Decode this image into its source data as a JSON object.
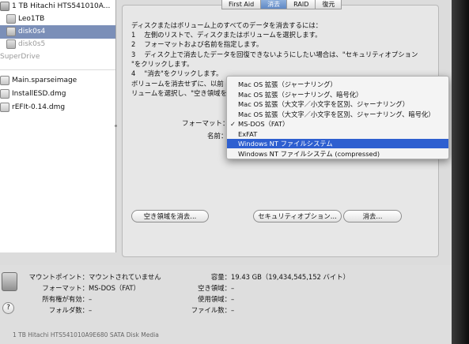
{
  "sidebar": {
    "items": [
      {
        "label": "1 TB Hitachi HTS541010A...",
        "state": "normal",
        "icon": "disk-icon"
      },
      {
        "label": "Leo1TB",
        "state": "normal",
        "icon": "volume-icon"
      },
      {
        "label": "disk0s4",
        "state": "selected",
        "icon": "volume-icon"
      },
      {
        "label": "disk0s5",
        "state": "gray",
        "icon": "volume-icon"
      },
      {
        "label": "SuperDrive",
        "state": "gray",
        "icon": "optical-drive-icon"
      },
      {
        "label": "Main.sparseimage",
        "state": "normal",
        "icon": "disk-image-icon"
      },
      {
        "label": "InstallESD.dmg",
        "state": "normal",
        "icon": "disk-image-icon"
      },
      {
        "label": "rEFIt-0.14.dmg",
        "state": "normal",
        "icon": "disk-image-icon"
      }
    ]
  },
  "tabs": [
    "First Aid",
    "消去",
    "RAID",
    "復元"
  ],
  "instructions": [
    "ディスクまたはボリューム上のすべてのデータを消去するには：",
    "1　 左側のリストで、ディスクまたはボリュームを選択します。",
    "2　 フォーマットおよび名前を指定します。",
    "3　 ディスク上で消去したデータを回復できないようにしたい場合は、\"セキュリティオプション",
    "\"をクリックします。",
    "4　 \"消去\"をクリックします。"
  ],
  "erase_note": [
    "ボリュームを消去せずに、以前",
    "リュームを選択し、\"空き領域を"
  ],
  "form": {
    "format_label": "フォーマット：",
    "name_label": "名前："
  },
  "dropdown": {
    "items": [
      {
        "label": "Mac OS 拡張（ジャーナリング）",
        "checked": false,
        "highlighted": false
      },
      {
        "label": "Mac OS 拡張（ジャーナリング、暗号化）",
        "checked": false,
        "highlighted": false
      },
      {
        "label": "Mac OS 拡張（大文字／小文字を区別、ジャーナリング）",
        "checked": false,
        "highlighted": false
      },
      {
        "label": "Mac OS 拡張（大文字／小文字を区別、ジャーナリング、暗号化）",
        "checked": false,
        "highlighted": false
      },
      {
        "label": "MS-DOS（FAT）",
        "checked": true,
        "highlighted": false
      },
      {
        "label": "ExFAT",
        "checked": false,
        "highlighted": false
      },
      {
        "label": "Windows NT ファイルシステム",
        "checked": false,
        "highlighted": true
      },
      {
        "label": "Windows NT ファイルシステム (compressed)",
        "checked": false,
        "highlighted": false
      }
    ],
    "check_mark": "✓"
  },
  "buttons": {
    "erase_free_space": "空き領域を消去...",
    "security_options": "セキュリティオプション...",
    "erase": "消去..."
  },
  "info": {
    "mount_point_key": "マウントポイント：",
    "mount_point_val": "マウントされていません",
    "format_key": "フォーマット：",
    "format_val": "MS-DOS（FAT）",
    "owners_key": "所有権が有効：",
    "owners_val": "–",
    "folders_key": "フォルダ数：",
    "folders_val": "–",
    "capacity_key": "容量：",
    "capacity_val": "19.43 GB（19,434,545,152 バイト）",
    "available_key": "空き領域：",
    "available_val": "–",
    "used_key": "使用領域：",
    "used_val": "–",
    "files_key": "ファイル数：",
    "files_val": "–"
  },
  "help_glyph": "?",
  "bottom_text": "1 TB Hitachi HTS541010A9E680 SATA Disk Media"
}
